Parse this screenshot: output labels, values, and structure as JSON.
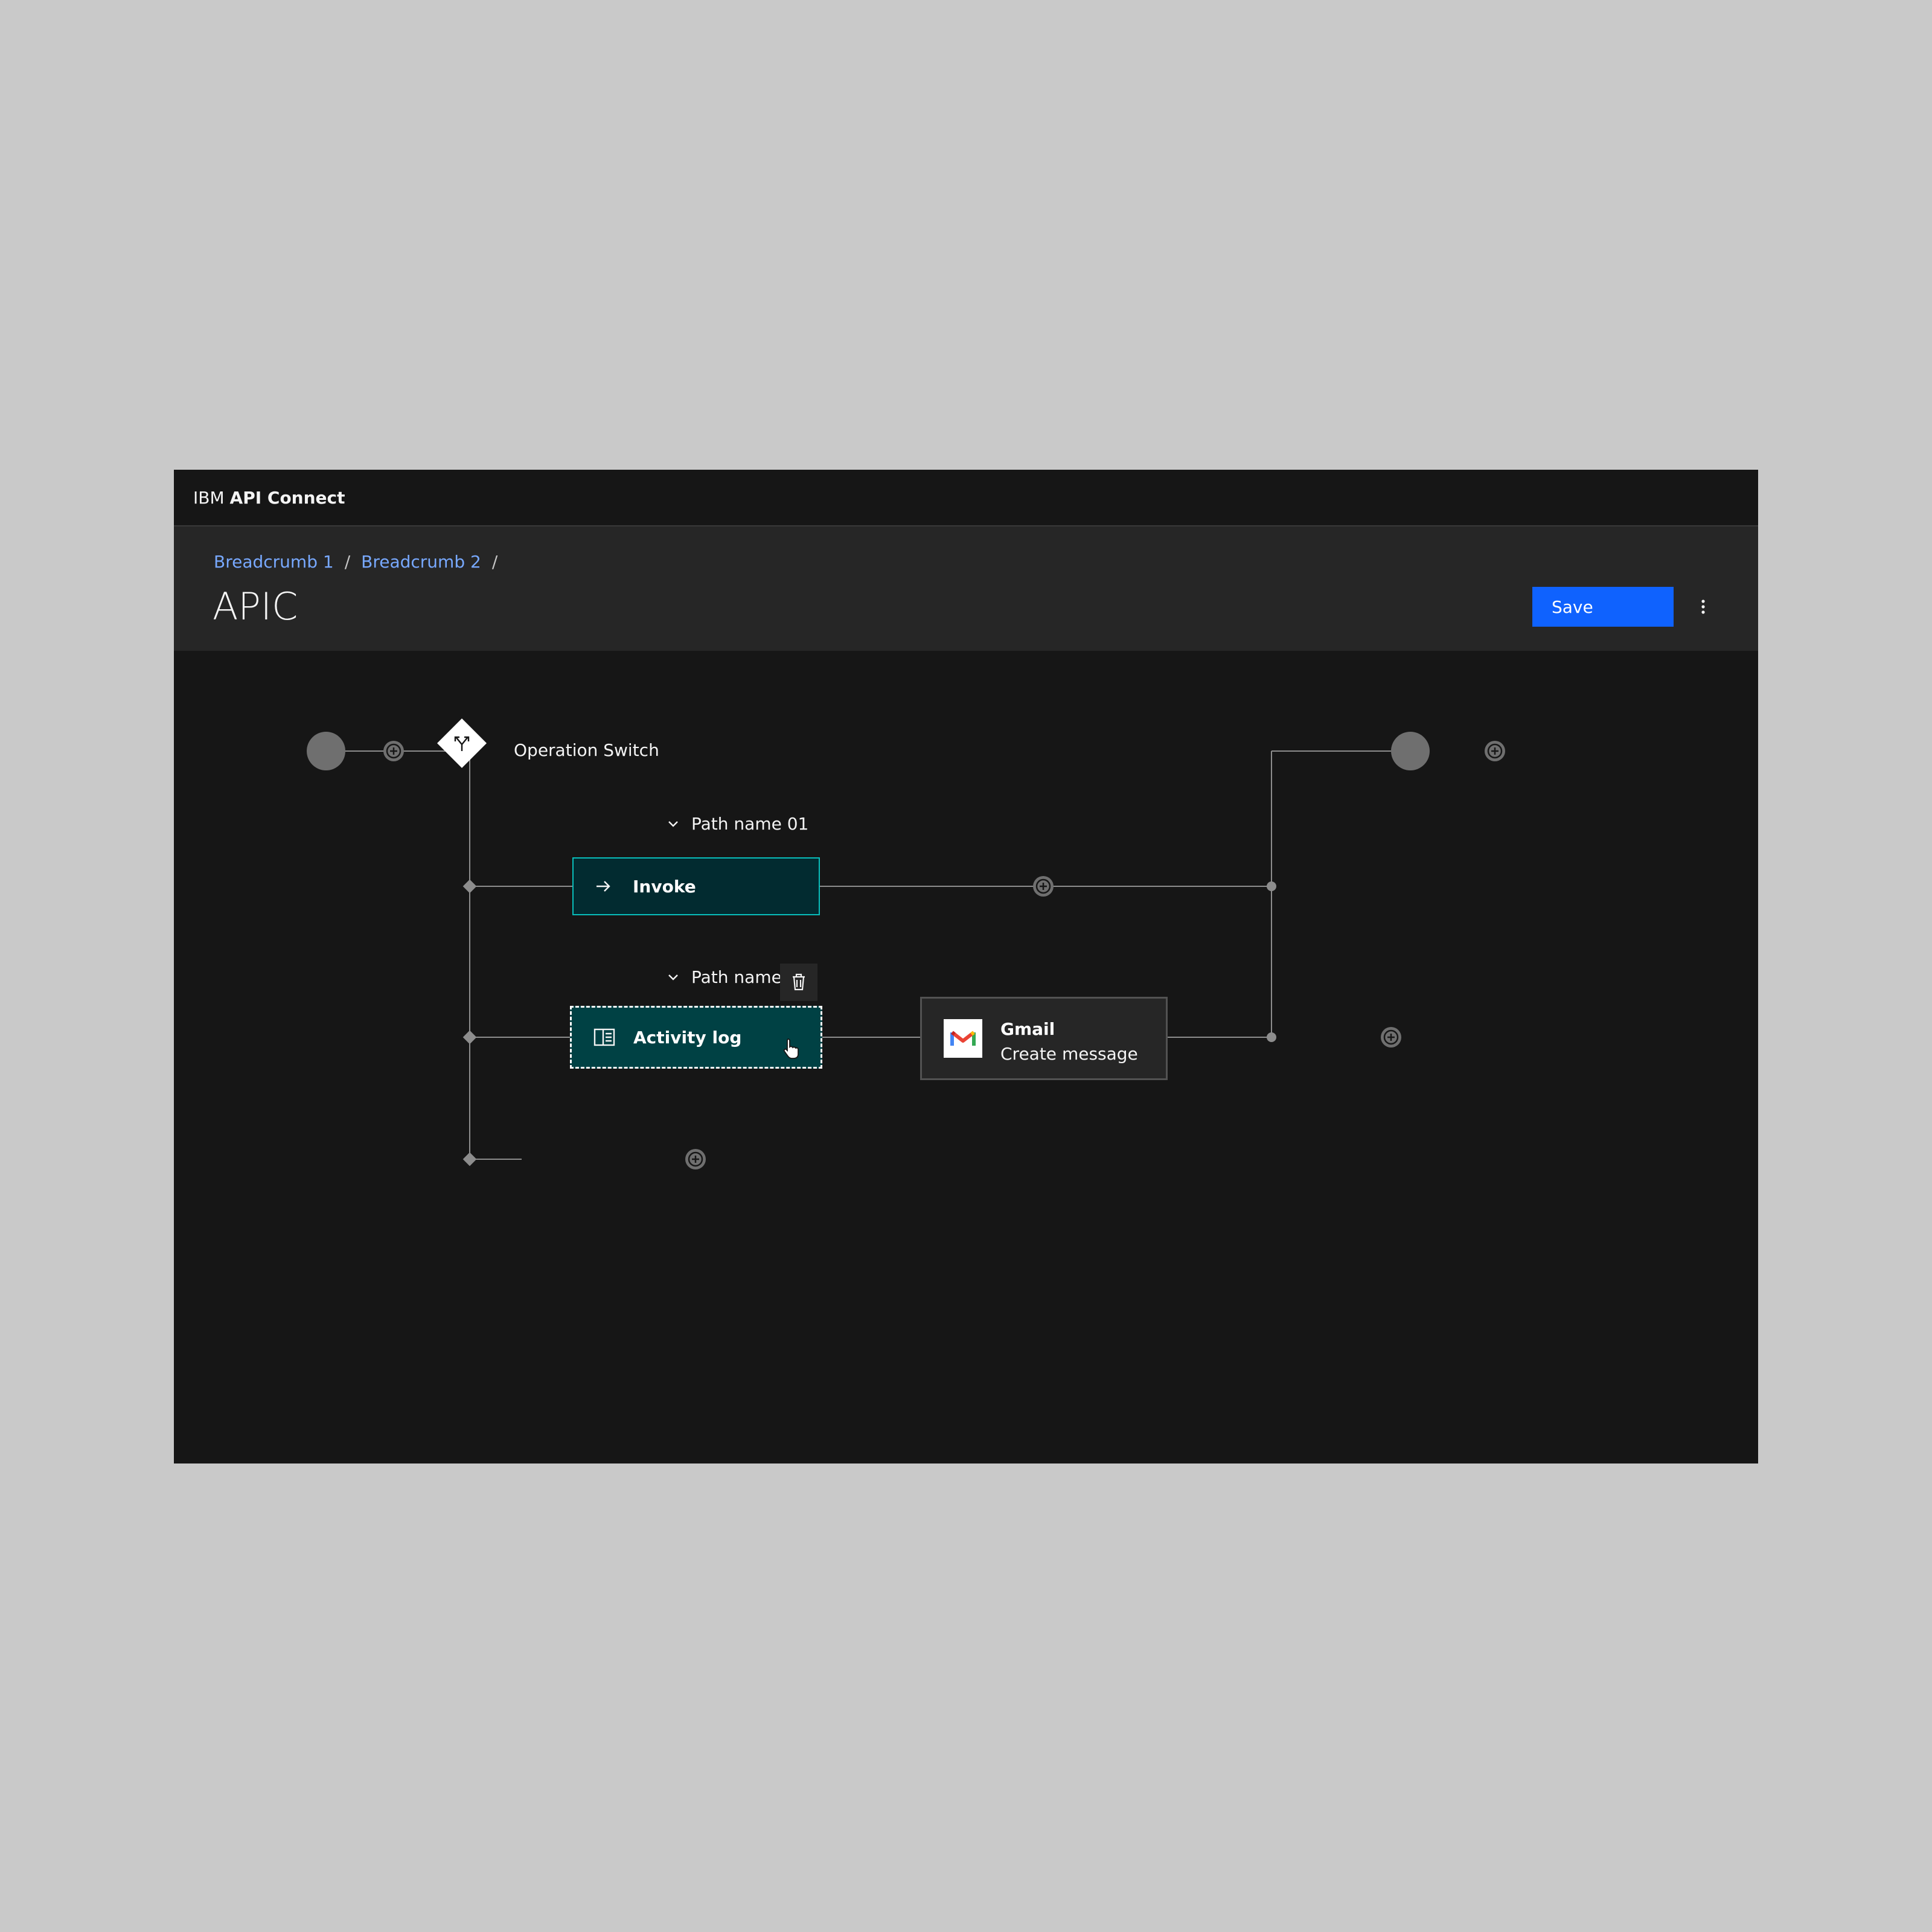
{
  "header": {
    "brand_prefix": "IBM",
    "brand_name": "API Connect"
  },
  "page": {
    "breadcrumbs": [
      "Breadcrumb 1",
      "Breadcrumb 2"
    ],
    "breadcrumb_separator": "/",
    "title": "APIC",
    "save_label": "Save"
  },
  "flow": {
    "switch_label": "Operation Switch",
    "paths": [
      {
        "name": "Path name 01",
        "nodes": [
          {
            "title": "Invoke",
            "icon": "arrow-right-icon"
          }
        ]
      },
      {
        "name": "Path name 02",
        "nodes": [
          {
            "title": "Activity log",
            "icon": "activity-log-icon",
            "selected": true
          },
          {
            "title": "Gmail",
            "subtitle": "Create message",
            "icon": "gmail-icon"
          }
        ]
      }
    ]
  },
  "colors": {
    "primary_button": "#0f62fe",
    "link": "#78a9ff",
    "invoke_border": "#08bdba",
    "activity_bg": "#004144"
  }
}
